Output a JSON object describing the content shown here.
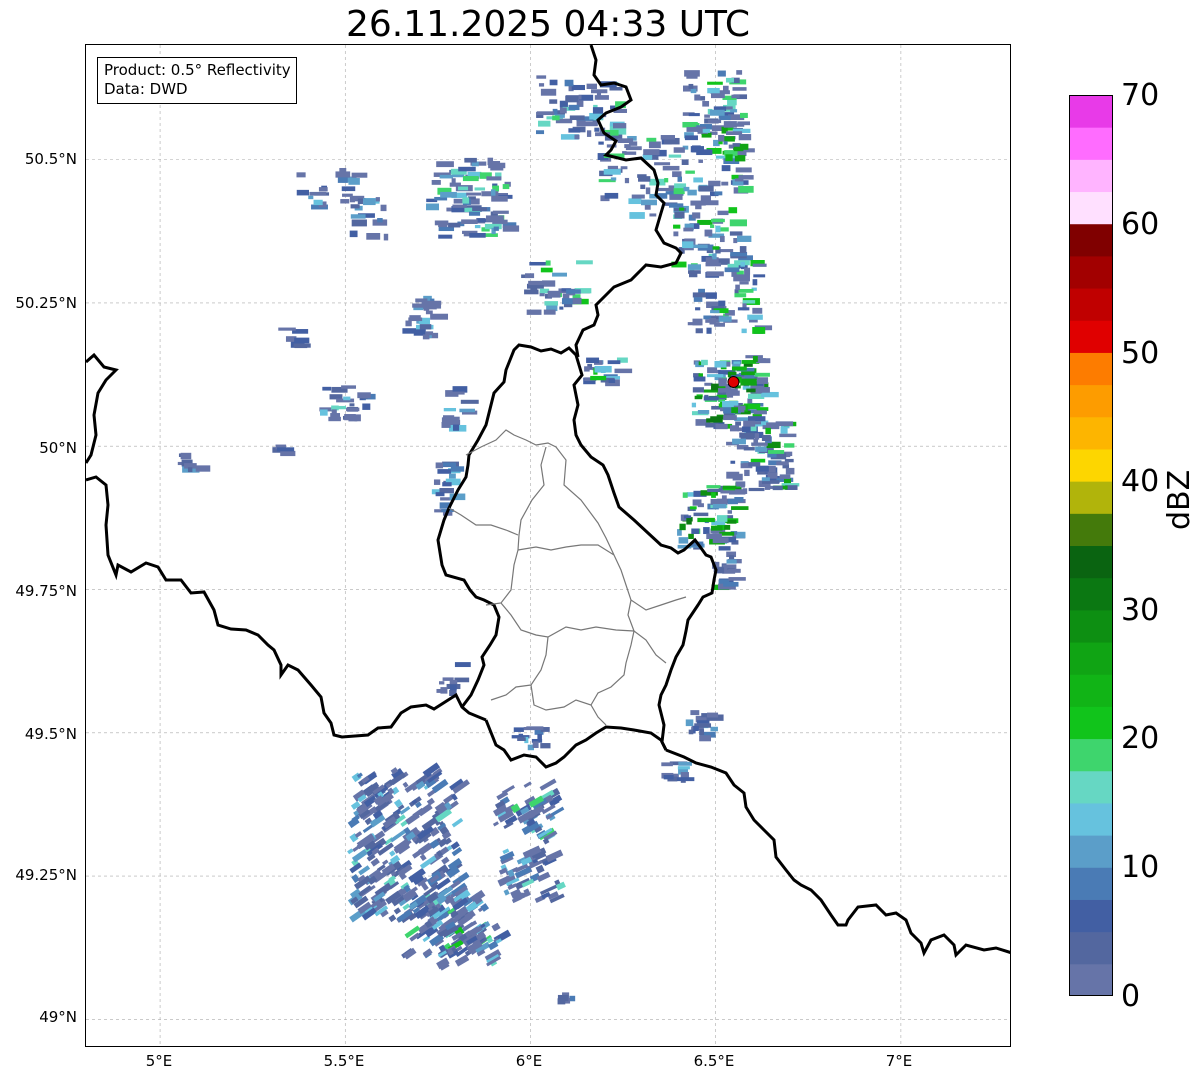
{
  "title": "26.11.2025 04:33 UTC",
  "info_box": {
    "product": "Product: 0.5° Reflectivity",
    "data": "Data: DWD"
  },
  "axes": {
    "lon_range": [
      4.8,
      7.3
    ],
    "lat_range": [
      48.95,
      50.7
    ],
    "x_ticks": [
      "5°E",
      "5.5°E",
      "6°E",
      "6.5°E",
      "7°E"
    ],
    "y_ticks": [
      "50.5°N",
      "50.25°N",
      "50°N",
      "49.75°N",
      "49.5°N",
      "49.25°N",
      "49°N"
    ],
    "gridlines": true
  },
  "colorbar": {
    "label": "dBZ",
    "ticks": [
      "70",
      "60",
      "50",
      "40",
      "30",
      "20",
      "10",
      "0"
    ],
    "range": [
      0,
      70
    ],
    "colors": [
      "#6674a8",
      "#53679f",
      "#425fa3",
      "#4a7bb5",
      "#5b9ec9",
      "#66c2de",
      "#66d7c3",
      "#3ed56d",
      "#11c41b",
      "#11b416",
      "#10a414",
      "#0d8f12",
      "#0b7812",
      "#0a6411",
      "#447a0b",
      "#b1b40b",
      "#fdd600",
      "#fdb500",
      "#fd9c00",
      "#fd7c00",
      "#e00000",
      "#c00000",
      "#a20000",
      "#800000",
      "#ffe0ff",
      "#ffb4ff",
      "#ff6cff",
      "#e83ae8"
    ]
  },
  "radar_marker": {
    "label": "radar-site",
    "color": "#e00000",
    "lon": 6.548,
    "lat": 50.112
  }
}
